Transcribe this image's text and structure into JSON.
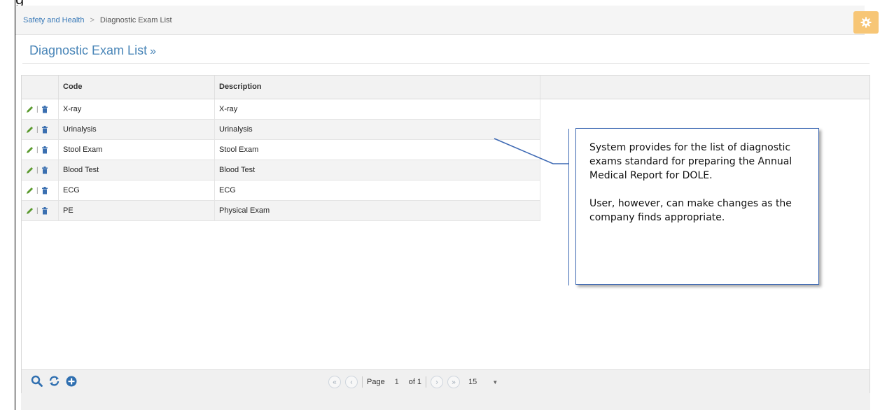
{
  "breadcrumb": {
    "parent": "Safety and Health",
    "separator": ">",
    "current": "Diagnostic Exam List"
  },
  "page_title": "Diagnostic Exam List",
  "page_title_suffix": "»",
  "grid": {
    "columns": [
      "Code",
      "Description"
    ],
    "rows": [
      {
        "code": "X-ray",
        "description": "X-ray"
      },
      {
        "code": "Urinalysis",
        "description": "Urinalysis"
      },
      {
        "code": "Stool Exam",
        "description": "Stool Exam"
      },
      {
        "code": "Blood Test",
        "description": "Blood Test"
      },
      {
        "code": "ECG",
        "description": "ECG"
      },
      {
        "code": "PE",
        "description": "Physical Exam"
      }
    ],
    "row_action_separator": "|"
  },
  "pager": {
    "page_label": "Page",
    "page_value": "1",
    "of_label": "of 1",
    "page_size": "15"
  },
  "callout": {
    "paragraph1": "System provides for the list of diagnostic exams standard for preparing the Annual Medical Report for DOLE.",
    "paragraph2": "User, however, can make changes as the company finds appropriate."
  },
  "icons": {
    "settings": "gear-icon",
    "edit": "pencil-icon",
    "delete": "trash-icon",
    "search": "search-icon",
    "refresh": "refresh-icon",
    "add": "plus-circle-icon",
    "first": "double-chevron-left-icon",
    "prev": "chevron-left-icon",
    "next": "chevron-right-icon",
    "last": "double-chevron-right-icon"
  },
  "colors": {
    "accent": "#4a86b8",
    "link": "#3a7ab8",
    "settings_button": "#f7c676",
    "edit_icon": "#5a9a2e",
    "delete_icon": "#3a6fb0",
    "footer_icon": "#2f6fb0",
    "callout_border": "#3c68b3"
  }
}
